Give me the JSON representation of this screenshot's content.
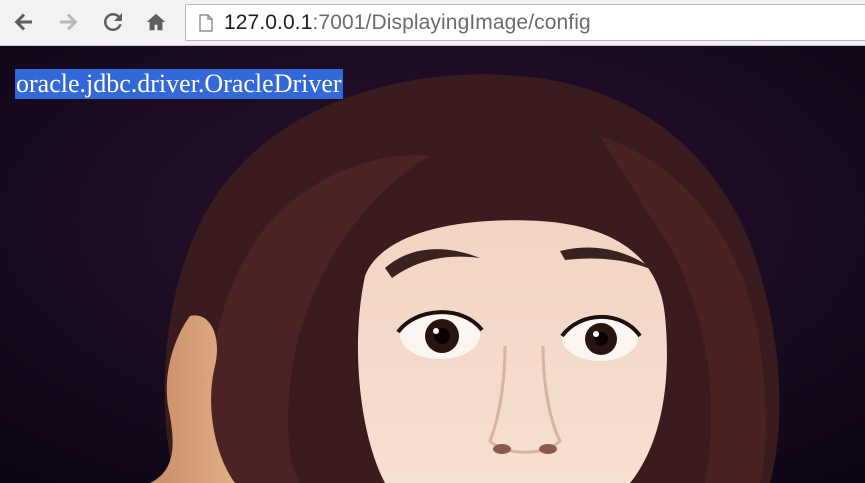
{
  "toolbar": {
    "back_icon": "back-arrow-icon",
    "forward_icon": "forward-arrow-icon",
    "reload_icon": "reload-icon",
    "home_icon": "home-icon",
    "address": {
      "host": "127.0.0.1",
      "path": ":7001/DisplayingImage/config",
      "page_icon": "page-icon"
    }
  },
  "page": {
    "text": "oracle.jdbc.driver.OracleDriver",
    "image": "portrait photo of a woman with wide eyes and brown hair"
  },
  "colors": {
    "selection": "#3368d9",
    "photo_background": "#1a0a22",
    "toolbar": "#f2f2f2"
  }
}
